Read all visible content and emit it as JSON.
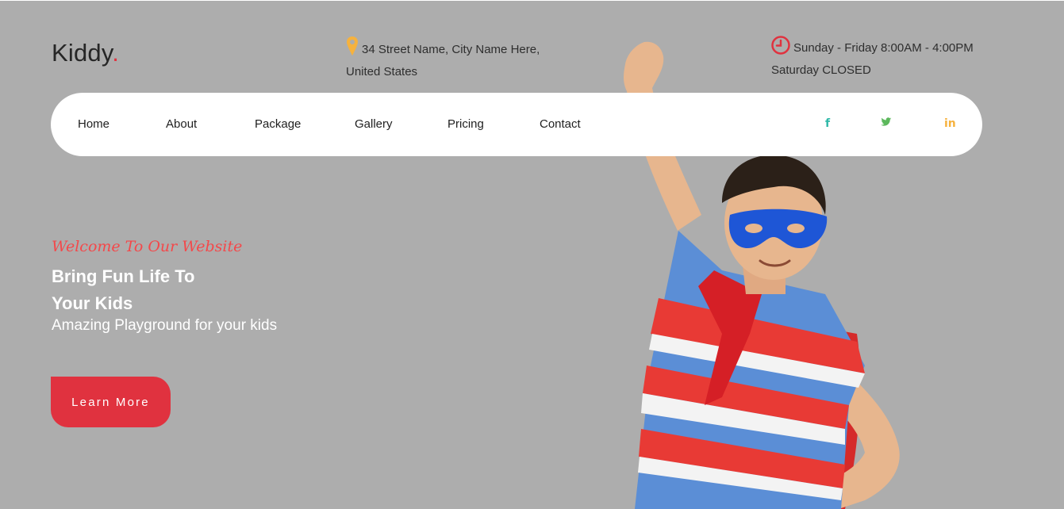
{
  "brand": {
    "name": "Kiddy",
    "dot": "."
  },
  "topbar": {
    "address_line1": "34 Street Name, City Name Here,",
    "address_line2": "United States",
    "hours_line1": "Sunday - Friday 8:00AM - 4:00PM",
    "hours_line2": "Saturday CLOSED",
    "address_icon": "map-pin-icon",
    "hours_icon": "clock-icon"
  },
  "nav": {
    "items": [
      {
        "label": "Home"
      },
      {
        "label": "About"
      },
      {
        "label": "Package"
      },
      {
        "label": "Gallery"
      },
      {
        "label": "Pricing"
      },
      {
        "label": "Contact"
      }
    ],
    "social": [
      {
        "glyph": "f",
        "icon": "facebook-icon"
      },
      {
        "glyph": "t",
        "icon": "twitter-icon"
      },
      {
        "glyph": "in",
        "icon": "linkedin-icon"
      }
    ]
  },
  "hero": {
    "welcome": "Welcome To Our Website",
    "headline_line1": "Bring Fun Life To",
    "headline_line2": "Your Kids",
    "subline": "Amazing Playground for your kids",
    "cta_label": "Learn More"
  },
  "colors": {
    "background": "#adadad",
    "accent": "#e0323f",
    "welcome": "#f4484a",
    "pin": "#f6b23e",
    "facebook": "#2fb8a8",
    "twitter": "#5cb85c",
    "linkedin": "#f6b23e"
  }
}
